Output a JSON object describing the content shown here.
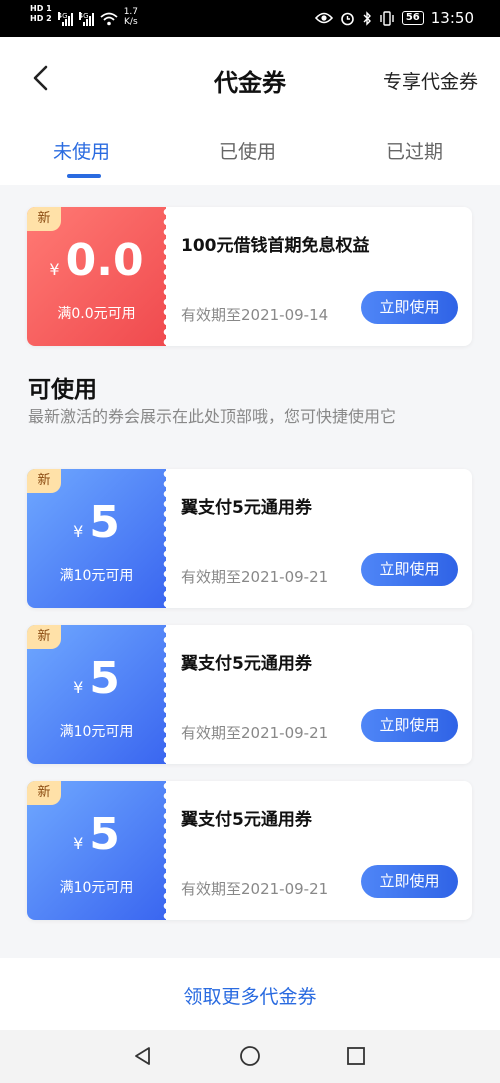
{
  "status": {
    "network_labels": [
      "HD 1",
      "HD 2"
    ],
    "signal_type": "4G",
    "speed_value": "1.7",
    "speed_unit": "K/s",
    "battery": "56",
    "time": "13:50"
  },
  "header": {
    "title": "代金券",
    "exclusive_link": "专享代金券"
  },
  "tabs": [
    {
      "label": "未使用",
      "active": true
    },
    {
      "label": "已使用",
      "active": false
    },
    {
      "label": "已过期",
      "active": false
    }
  ],
  "featured": {
    "badge": "新",
    "currency": "¥",
    "amount": "0.0",
    "condition": "满0.0元可用",
    "title": "100元借钱首期免息权益",
    "expiry": "有效期至2021-09-14",
    "button": "立即使用"
  },
  "section": {
    "title": "可使用",
    "description": "最新激活的券会展示在此处顶部哦，您可快捷使用它"
  },
  "coupons": [
    {
      "badge": "新",
      "currency": "¥",
      "amount": "5",
      "condition": "满10元可用",
      "title": "翼支付5元通用券",
      "expiry": "有效期至2021-09-21",
      "button": "立即使用"
    },
    {
      "badge": "新",
      "currency": "¥",
      "amount": "5",
      "condition": "满10元可用",
      "title": "翼支付5元通用券",
      "expiry": "有效期至2021-09-21",
      "button": "立即使用"
    },
    {
      "badge": "新",
      "currency": "¥",
      "amount": "5",
      "condition": "满10元可用",
      "title": "翼支付5元通用券",
      "expiry": "有效期至2021-09-21",
      "button": "立即使用"
    }
  ],
  "footer": {
    "more_label": "领取更多代金券"
  },
  "colors": {
    "accent": "#2a6be0",
    "coupon_red": "#f04a4e",
    "coupon_blue": "#3a66f0",
    "badge": "#ffe1a8"
  },
  "icons": [
    "back-arrow-icon",
    "eye-icon",
    "alarm-icon",
    "bluetooth-icon",
    "vibrate-icon",
    "wifi-icon",
    "nav-back-icon",
    "nav-home-icon",
    "nav-recents-icon"
  ]
}
